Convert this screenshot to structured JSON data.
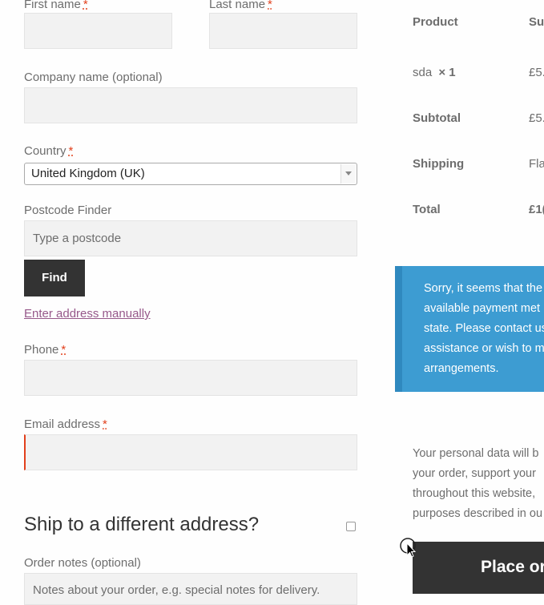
{
  "billing": {
    "first_name_label": "First name",
    "last_name_label": "Last name",
    "required_mark": "*",
    "company_label": "Company name (optional)",
    "country_label": "Country",
    "country_value": "United Kingdom (UK)",
    "postcode_finder_label": "Postcode Finder",
    "postcode_placeholder": "Type a postcode",
    "find_button": "Find",
    "manual_link": "Enter address manually",
    "phone_label": "Phone",
    "email_label": "Email address",
    "ship_heading": "Ship to a different address?",
    "order_notes_label": "Order notes (optional)",
    "order_notes_placeholder": "Notes about your order, e.g. special notes for delivery."
  },
  "order_review": {
    "product_header": "Product",
    "subtotal_header": "Su",
    "product_name": "sda",
    "product_qty": "× 1",
    "product_price": "£5.",
    "subtotal_label": "Subtotal",
    "subtotal_value": "£5.",
    "shipping_label": "Shipping",
    "shipping_value": "Fla",
    "total_label": "Total",
    "total_value": "£1("
  },
  "notice": {
    "lines": [
      "Sorry, it seems that the",
      "available payment met",
      "state. Please contact us",
      "assistance or wish to m",
      "arrangements."
    ]
  },
  "privacy": {
    "lines": [
      "Your personal data will b",
      "your order, support your",
      "throughout this website,",
      "purposes described in ou"
    ]
  },
  "place_order_button": "Place ord",
  "colors": {
    "notice_bg": "#3d9cd2",
    "button_dark": "#333333",
    "link": "#96588a",
    "required": "#e2401c"
  }
}
